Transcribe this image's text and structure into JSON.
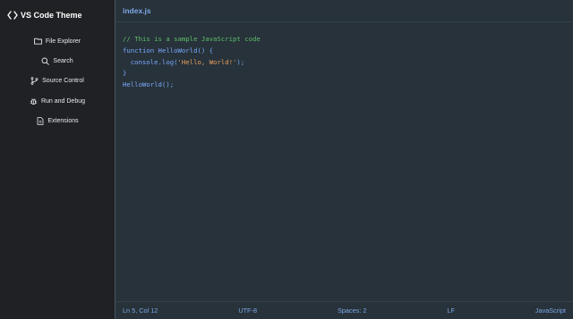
{
  "sidebar": {
    "brand": {
      "icon": "code-brackets-icon",
      "title": "VS Code Theme"
    },
    "items": [
      {
        "label": "File Explorer",
        "icon": "folder-icon"
      },
      {
        "label": "Search",
        "icon": "search-icon"
      },
      {
        "label": "Source Control",
        "icon": "git-branch-icon"
      },
      {
        "label": "Run and Debug",
        "icon": "bug-icon"
      },
      {
        "label": "Extensions",
        "icon": "file-icon"
      }
    ]
  },
  "tab": {
    "label": "index.js"
  },
  "code": {
    "lines": [
      {
        "parts": [
          {
            "t": "comment",
            "text": "// This is a sample JavaScript code"
          }
        ]
      },
      {
        "parts": [
          {
            "t": "kw",
            "text": "function "
          },
          {
            "t": "fn",
            "text": "HelloWorld() {"
          }
        ]
      },
      {
        "parts": [
          {
            "t": "plain",
            "text": "  console.log("
          },
          {
            "t": "str",
            "text": "'Hello, World!'"
          },
          {
            "t": "plain",
            "text": ");"
          }
        ]
      },
      {
        "parts": [
          {
            "t": "plain",
            "text": "}"
          }
        ]
      },
      {
        "parts": [
          {
            "t": "plain",
            "text": "HelloWorld();"
          }
        ]
      }
    ]
  },
  "status": {
    "position": "Ln 5, Col 12",
    "encoding": "UTF-8",
    "indent": "Spaces: 2",
    "eol": "LF",
    "language": "JavaScript"
  },
  "colors": {
    "sidebar_bg": "#1f2124",
    "editor_bg": "#27323a",
    "accent": "#7ea7e8",
    "comment": "#5fbf6a",
    "string": "#e8a060"
  }
}
